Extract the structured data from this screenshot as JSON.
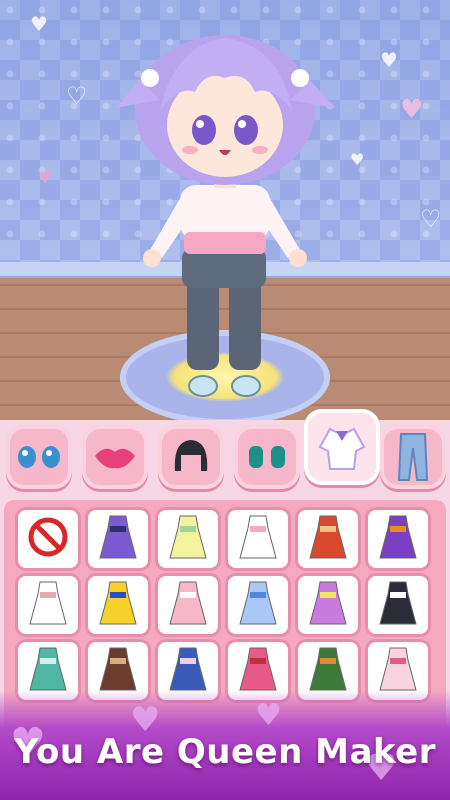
{
  "colors": {
    "wall": "#a9b9ec",
    "floor": "#b98a74",
    "tab_bg": "#f7b7cb",
    "panel_bg": "#f5a9c1",
    "banner": "#9a2fb5"
  },
  "category_tabs": [
    {
      "name": "eyes",
      "icon": "eyes-icon"
    },
    {
      "name": "lips",
      "icon": "lips-icon"
    },
    {
      "name": "hair",
      "icon": "hair-icon"
    },
    {
      "name": "shoes",
      "icon": "shoes-icon"
    },
    {
      "name": "tops",
      "icon": "dress-top-icon",
      "selected": true
    },
    {
      "name": "pants",
      "icon": "jeans-icon"
    }
  ],
  "items": [
    {
      "icon": "none-icon"
    },
    {
      "icon": "purple-gothic-dress-icon"
    },
    {
      "icon": "yellow-gown-icon"
    },
    {
      "icon": "white-pink-sweater-icon"
    },
    {
      "icon": "red-folk-dress-icon"
    },
    {
      "icon": "purple-orange-gown-icon"
    },
    {
      "icon": "white-jacket-icon"
    },
    {
      "icon": "snow-white-dress-icon"
    },
    {
      "icon": "pink-jacket-icon"
    },
    {
      "icon": "blue-ballgown-icon"
    },
    {
      "icon": "purple-yellow-gown-icon"
    },
    {
      "icon": "black-white-dress-icon"
    },
    {
      "icon": "teal-gown-icon"
    },
    {
      "icon": "brown-striped-dress-icon"
    },
    {
      "icon": "blue-hanbok-icon"
    },
    {
      "icon": "pink-red-dress-icon"
    },
    {
      "icon": "green-tribal-dress-icon"
    },
    {
      "icon": "pink-floral-dress-icon"
    }
  ],
  "banner": {
    "text": "You Are Queen Maker"
  }
}
